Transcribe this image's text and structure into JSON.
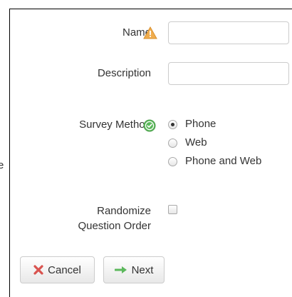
{
  "form": {
    "edge_fragment": "e",
    "name_label": "Name",
    "name_value": "",
    "description_label": "Description",
    "description_value": "",
    "survey_method_label": "Survey Method",
    "survey_method_options": [
      {
        "label": "Phone",
        "checked": true
      },
      {
        "label": "Web",
        "checked": false
      },
      {
        "label": "Phone and Web",
        "checked": false
      }
    ],
    "randomize_label_line1": "Randomize",
    "randomize_label_line2": "Question Order",
    "randomize_checked": false
  },
  "buttons": {
    "cancel_label": "Cancel",
    "next_label": "Next"
  },
  "icons": {
    "warning": "warning-icon",
    "ok": "check-circle-icon",
    "cancel": "x-icon",
    "next": "arrow-right-icon"
  },
  "colors": {
    "warning": "#f0ad4e",
    "ok": "#5cb85c",
    "cancel": "#d9534f",
    "next": "#5cb85c"
  }
}
